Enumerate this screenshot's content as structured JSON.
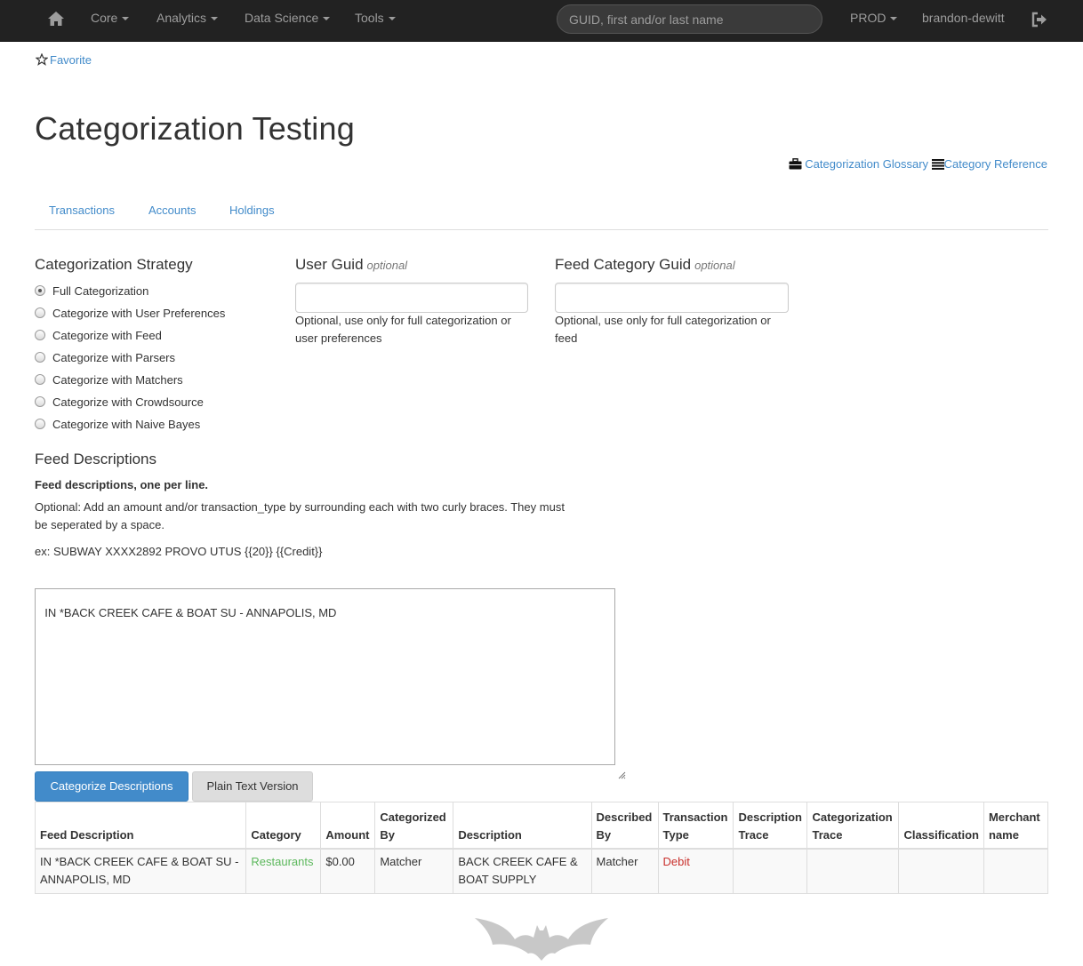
{
  "navbar": {
    "menus": [
      "Core",
      "Analytics",
      "Data Science",
      "Tools"
    ],
    "search_placeholder": "GUID, first and/or last name",
    "environment": "PROD",
    "user": "brandon-dewitt"
  },
  "favorite_label": "Favorite",
  "page_title": "Categorization Testing",
  "links": {
    "glossary": "Categorization Glossary",
    "reference": "Category Reference"
  },
  "tabs": [
    "Transactions",
    "Accounts",
    "Holdings"
  ],
  "strategy": {
    "heading": "Categorization Strategy",
    "selected_index": 0,
    "options": [
      "Full Categorization",
      "Categorize with User Preferences",
      "Categorize with Feed",
      "Categorize with Parsers",
      "Categorize with Matchers",
      "Categorize with Crowdsource",
      "Categorize with Naive Bayes"
    ]
  },
  "user_guid": {
    "label": "User Guid",
    "optional": "optional",
    "value": "",
    "help_line1": "Optional, use only for full categorization or",
    "help_line2": "user preferences"
  },
  "feed_category_guid": {
    "label": "Feed Category Guid",
    "optional": "optional",
    "value": "",
    "help_line1": "Optional, use only for full categorization or",
    "help_line2": "feed"
  },
  "feed_descriptions": {
    "heading": "Feed Descriptions",
    "bold_note": "Feed descriptions, one per line.",
    "instructions_line1": "Optional: Add an amount and/or transaction_type by surrounding each with two curly braces. They must",
    "instructions_line2": "be seperated by a space.",
    "example": "ex: SUBWAY XXXX2892 PROVO UTUS {{20}} {{Credit}}",
    "textarea_value": "IN *BACK CREEK CAFE & BOAT SU - ANNAPOLIS, MD"
  },
  "buttons": {
    "categorize": "Categorize Descriptions",
    "plain_text": "Plain Text Version"
  },
  "table": {
    "headers": {
      "feed_description": "Feed Description",
      "category": "Category",
      "amount": "Amount",
      "categorized_by_1": "Categorized",
      "categorized_by_2": "By",
      "description": "Description",
      "described_by_1": "Described",
      "described_by_2": "By",
      "transaction_type_1": "Transaction",
      "transaction_type_2": "Type",
      "description_trace_1": "Description",
      "description_trace_2": "Trace",
      "categorization_trace_1": "Categorization",
      "categorization_trace_2": "Trace",
      "classification": "Classification",
      "merchant_name_1": "Merchant",
      "merchant_name_2": "name"
    },
    "rows": [
      {
        "feed_description_1": "IN *BACK CREEK CAFE & BOAT SU -",
        "feed_description_2": "ANNAPOLIS, MD",
        "category": "Restaurants",
        "amount": "$0.00",
        "categorized_by": "Matcher",
        "description_1": "BACK CREEK CAFE &",
        "description_2": "BOAT SUPPLY",
        "described_by": "Matcher",
        "transaction_type": "Debit",
        "description_trace": "",
        "categorization_trace": "",
        "classification": "",
        "merchant_name": ""
      }
    ]
  },
  "colors": {
    "navbar_bg": "#222222",
    "link": "#428bca",
    "primary_button": "#428bca",
    "category_green": "#5cb85c",
    "debit_red": "#c9302c"
  },
  "icons": [
    "home-icon",
    "signout-icon",
    "star-icon",
    "briefcase-icon",
    "list-icon",
    "bat-logo"
  ]
}
